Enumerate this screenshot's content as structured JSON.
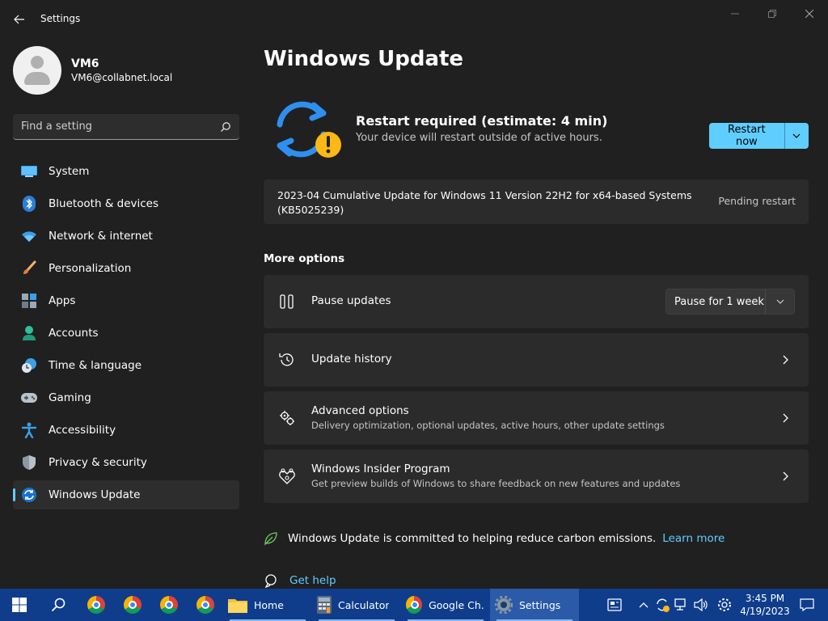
{
  "window": {
    "title": "Settings"
  },
  "profile": {
    "name": "VM6",
    "email": "VM6@collabnet.local"
  },
  "search": {
    "placeholder": "Find a setting"
  },
  "sidebar": {
    "items": [
      {
        "label": "System",
        "icon": "system-icon"
      },
      {
        "label": "Bluetooth & devices",
        "icon": "bluetooth-icon"
      },
      {
        "label": "Network & internet",
        "icon": "wifi-icon"
      },
      {
        "label": "Personalization",
        "icon": "brush-icon"
      },
      {
        "label": "Apps",
        "icon": "apps-icon"
      },
      {
        "label": "Accounts",
        "icon": "accounts-icon"
      },
      {
        "label": "Time & language",
        "icon": "clock-globe-icon"
      },
      {
        "label": "Gaming",
        "icon": "gamepad-icon"
      },
      {
        "label": "Accessibility",
        "icon": "accessibility-icon"
      },
      {
        "label": "Privacy & security",
        "icon": "shield-icon"
      },
      {
        "label": "Windows Update",
        "icon": "update-icon",
        "active": true
      }
    ]
  },
  "main": {
    "title": "Windows Update",
    "status_title": "Restart required (estimate: 4 min)",
    "status_subtitle": "Your device will restart outside of active hours.",
    "restart_button": "Restart now",
    "pending_update": {
      "name": "2023-04 Cumulative Update for Windows 11 Version 22H2 for x64-based Systems (KB5025239)",
      "status": "Pending restart"
    },
    "more_options_title": "More options",
    "pause": {
      "label": "Pause updates",
      "selected": "Pause for 1 week"
    },
    "options": [
      {
        "title": "Update history",
        "subtitle": ""
      },
      {
        "title": "Advanced options",
        "subtitle": "Delivery optimization, optional updates, active hours, other update settings"
      },
      {
        "title": "Windows Insider Program",
        "subtitle": "Get preview builds of Windows to share feedback on new features and updates"
      }
    ],
    "carbon_text": "Windows Update is committed to helping reduce carbon emissions.",
    "learn_more": "Learn more",
    "get_help": "Get help"
  },
  "taskbar": {
    "apps": [
      {
        "label": "Home",
        "icon": "file-explorer-icon"
      },
      {
        "label": "Calculator",
        "icon": "calculator-icon"
      },
      {
        "label": "Google Ch...",
        "icon": "chrome-icon"
      },
      {
        "label": "Settings",
        "icon": "settings-gear-icon",
        "active": true
      }
    ],
    "time": "3:45 PM",
    "date": "4/19/2023"
  },
  "colors": {
    "accent": "#60cdff",
    "background": "#202020",
    "card": "#2b2b2b",
    "taskbar": "#0f3d8c",
    "warning": "#fcb814"
  }
}
